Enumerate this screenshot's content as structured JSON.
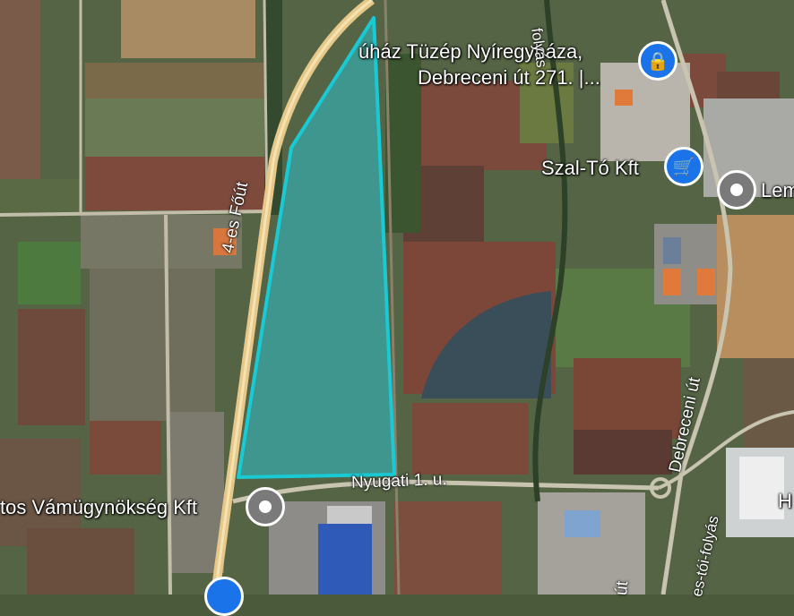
{
  "map": {
    "places": [
      {
        "id": "tuzep",
        "name_line1": "úház Tüzép Nyíregyháza,",
        "name_line2": "Debreceni út 271. |...",
        "icon": "lock-bag-icon"
      },
      {
        "id": "szalto",
        "name": "Szal-Tó Kft",
        "icon": "shopping-cart-icon"
      },
      {
        "id": "lem",
        "name": "Lem",
        "icon": "place-pin-icon"
      },
      {
        "id": "vam",
        "name": "tos Vámügynökség Kft",
        "icon": "place-pin-icon"
      },
      {
        "id": "h",
        "name": "H",
        "icon": "place-pin-icon"
      }
    ],
    "roads": {
      "main_road": "4-es Főút",
      "nyugati": "Nyugati 1. u.",
      "debreceni": "Debreceni út",
      "ut": "út",
      "folyas_top": "folyás",
      "folyas_bottom": "es-tói-folyás"
    },
    "colors": {
      "polygon_fill": "#2fb8c0",
      "polygon_stroke": "#19c9d4",
      "pin_blue": "#1a73e8",
      "pin_gray": "#7a7a7a"
    }
  }
}
